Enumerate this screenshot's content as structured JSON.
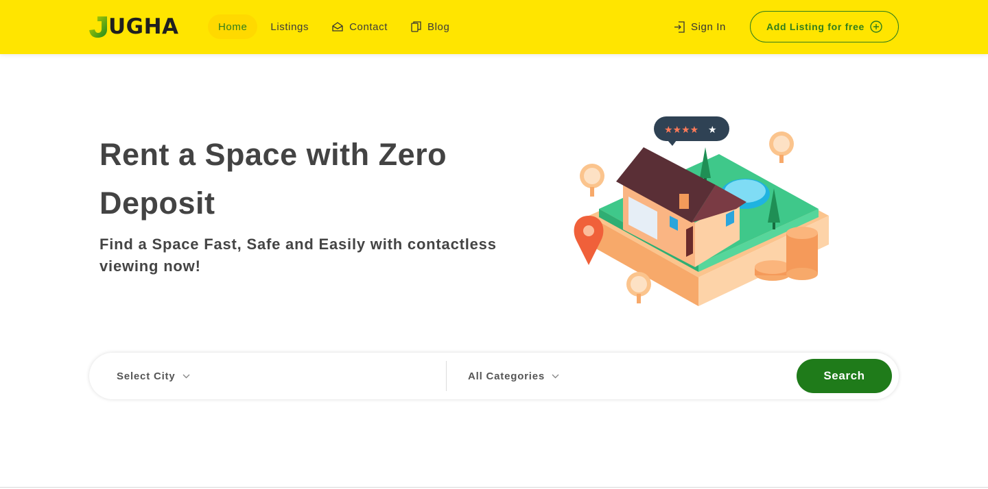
{
  "header": {
    "logo_text": "UGHA",
    "nav": [
      {
        "label": "Home",
        "icon": "none",
        "active": true
      },
      {
        "label": "Listings",
        "icon": "none",
        "active": false
      },
      {
        "label": "Contact",
        "icon": "envelope-open-icon",
        "active": false
      },
      {
        "label": "Blog",
        "icon": "copy-icon",
        "active": false
      }
    ],
    "sign_in_label": "Sign In",
    "add_listing_label": "Add Listing for free"
  },
  "hero": {
    "title": "Rent a Space with Zero Deposit",
    "subtitle": "Find a Space Fast, Safe and Easily with contactless viewing now!"
  },
  "search": {
    "city_placeholder": "Select City",
    "category_placeholder": "All Categories",
    "button_label": "Search"
  },
  "colors": {
    "header_bg": "#ffe500",
    "accent_green": "#2f7d1c",
    "button_green": "#1f7b1a",
    "text_dark": "#434343"
  }
}
